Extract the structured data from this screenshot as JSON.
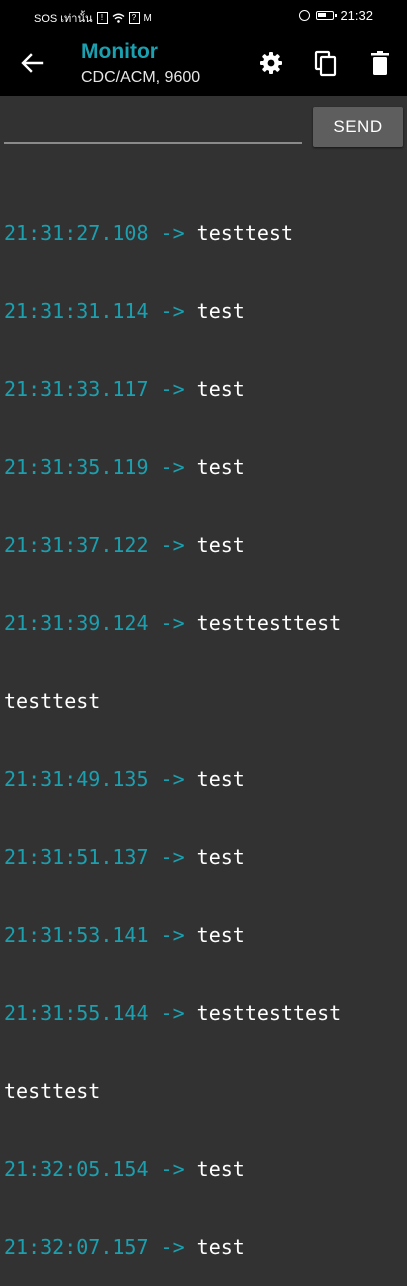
{
  "status_bar": {
    "left_text": "SOS เท่านั้น",
    "time": "21:32"
  },
  "app_bar": {
    "title": "Monitor",
    "subtitle": "CDC/ACM, 9600",
    "icons": [
      "back-arrow-icon",
      "settings-gear-icon",
      "copy-icon",
      "trash-icon"
    ]
  },
  "send": {
    "input_value": "",
    "button_label": "SEND"
  },
  "log": [
    {
      "time": "21:31:27.108",
      "arrow": " -> ",
      "text": "testtest"
    },
    {
      "time": "21:31:31.114",
      "arrow": " -> ",
      "text": "test"
    },
    {
      "time": "21:31:33.117",
      "arrow": " -> ",
      "text": "test"
    },
    {
      "time": "21:31:35.119",
      "arrow": " -> ",
      "text": "test"
    },
    {
      "time": "21:31:37.122",
      "arrow": " -> ",
      "text": "test"
    },
    {
      "time": "21:31:39.124",
      "arrow": " -> ",
      "text": "testtesttest"
    },
    {
      "time": "",
      "arrow": "",
      "text": "testtest"
    },
    {
      "time": "21:31:49.135",
      "arrow": " -> ",
      "text": "test"
    },
    {
      "time": "21:31:51.137",
      "arrow": " -> ",
      "text": "test"
    },
    {
      "time": "21:31:53.141",
      "arrow": " -> ",
      "text": "test"
    },
    {
      "time": "21:31:55.144",
      "arrow": " -> ",
      "text": "testtesttest"
    },
    {
      "time": "",
      "arrow": "",
      "text": "testtest"
    },
    {
      "time": "21:32:05.154",
      "arrow": " -> ",
      "text": "test"
    },
    {
      "time": "21:32:07.157",
      "arrow": " -> ",
      "text": "test"
    }
  ],
  "colors": {
    "accent": "#1ba0b0",
    "background": "#323232",
    "appbar": "#000000"
  }
}
